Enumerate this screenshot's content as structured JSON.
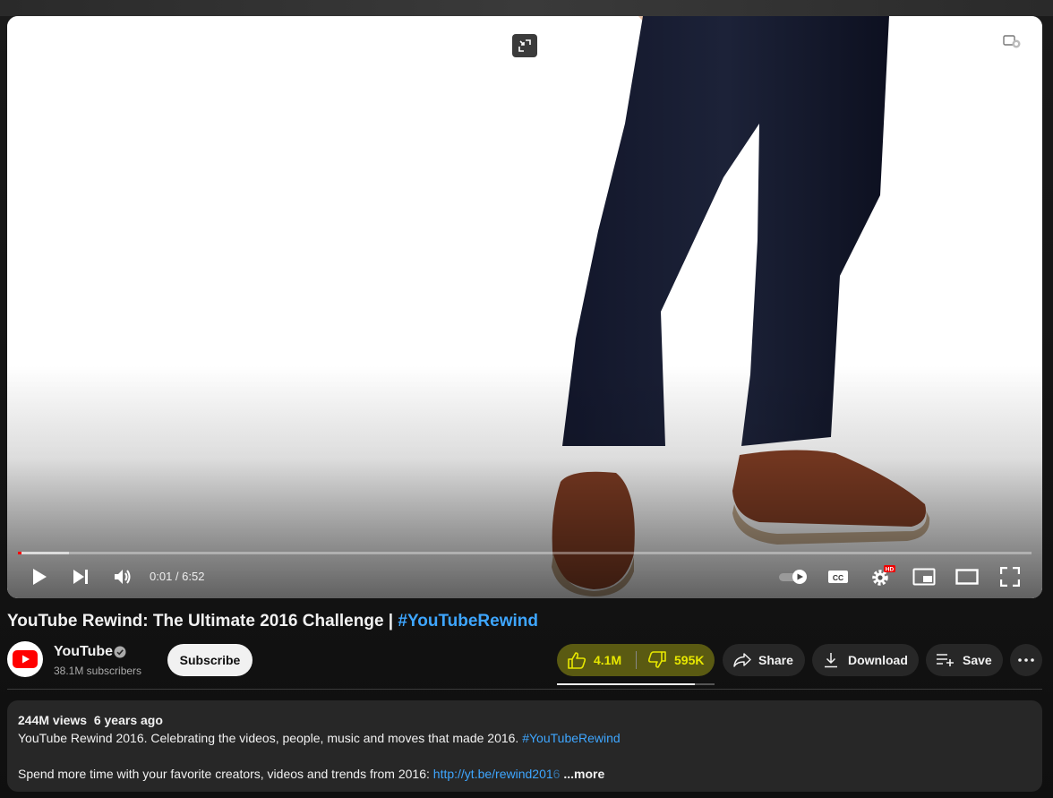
{
  "player": {
    "current_time": "0:01",
    "separator": " / ",
    "duration": "6:52",
    "played_fraction": 0.003,
    "buffered_fraction": 0.05,
    "hd_badge": "HD",
    "icons": {
      "exit_fullscreen": "exit-fullscreen-icon",
      "cast": "cast-icon",
      "play": "play-icon",
      "next": "next-icon",
      "volume": "volume-icon",
      "autoplay": "autoplay-toggle-icon",
      "captions": "captions-icon",
      "settings": "settings-icon",
      "miniplayer": "miniplayer-icon",
      "theater": "theater-icon",
      "fullscreen": "fullscreen-icon"
    },
    "captions_label": "CC"
  },
  "video": {
    "title": "YouTube Rewind: The Ultimate 2016 Challenge | ",
    "title_hashtag": "#YouTubeRewind"
  },
  "channel": {
    "name": "YouTube",
    "subscribers": "38.1M subscribers",
    "subscribe_label": "Subscribe"
  },
  "actions": {
    "likes": "4.1M",
    "dislikes": "595K",
    "like_ratio": 0.875,
    "share_label": "Share",
    "download_label": "Download",
    "save_label": "Save"
  },
  "description": {
    "views": "244M views",
    "age": "6 years ago",
    "line1_text": "YouTube Rewind 2016. Celebrating the videos, people, music and moves that made 2016. ",
    "line1_hashtag": "#YouTubeRewind",
    "line2_text": "Spend more time with your favorite creators, videos and trends from 2016: ",
    "line2_link": "http://yt.be/rewind201",
    "line2_link_fade": "6",
    "more_label": " ...more"
  },
  "colors": {
    "background": "#0f0f0f",
    "surface": "#272727",
    "link": "#3ea6ff",
    "highlight": "#e8e800",
    "progress": "#ff0000"
  }
}
